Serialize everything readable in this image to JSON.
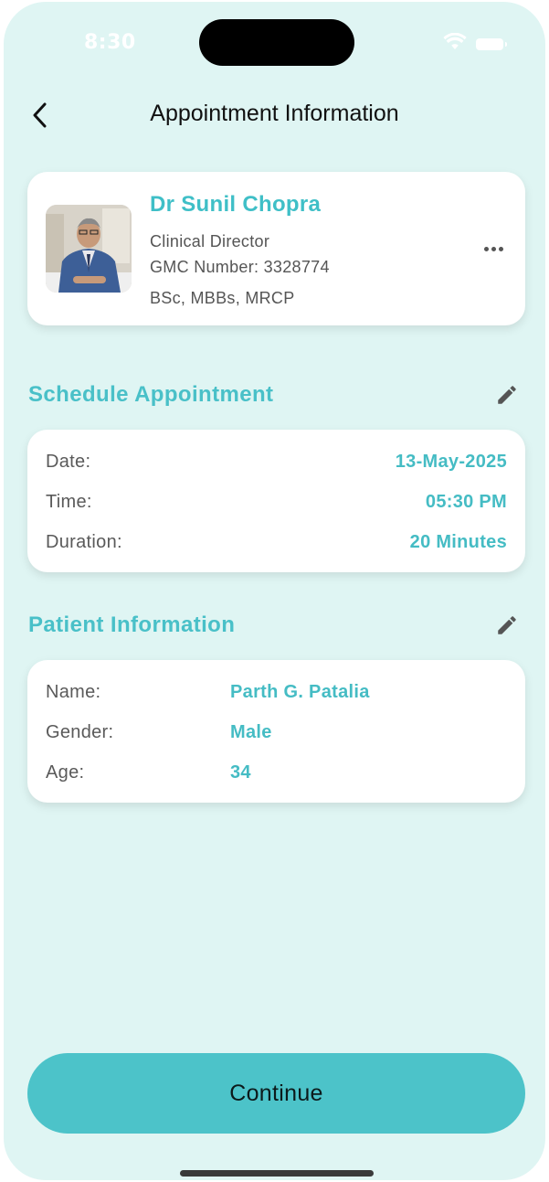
{
  "status_bar": {
    "time": "8:30"
  },
  "header": {
    "title": "Appointment Information",
    "back_icon": "chevron-left-icon"
  },
  "doctor": {
    "name": "Dr Sunil Chopra",
    "role": "Clinical Director",
    "gmc": "GMC Number: 3328774",
    "qualifications": "BSc, MBBs, MRCP",
    "more_icon": "more-horizontal-icon"
  },
  "schedule": {
    "title": "Schedule Appointment",
    "edit_icon": "pencil-icon",
    "rows": [
      {
        "label": "Date:",
        "value": "13-May-2025"
      },
      {
        "label": "Time:",
        "value": "05:30 PM"
      },
      {
        "label": "Duration:",
        "value": "20 Minutes"
      }
    ]
  },
  "patient": {
    "title": "Patient Information",
    "edit_icon": "pencil-icon",
    "rows": [
      {
        "label": "Name:",
        "value": "Parth G. Patalia"
      },
      {
        "label": "Gender:",
        "value": "Male"
      },
      {
        "label": "Age:",
        "value": "34"
      }
    ]
  },
  "actions": {
    "continue_label": "Continue"
  },
  "colors": {
    "background": "#dff5f3",
    "accent": "#4cc3c9",
    "accent_text": "#45bcc4",
    "card": "#ffffff"
  }
}
